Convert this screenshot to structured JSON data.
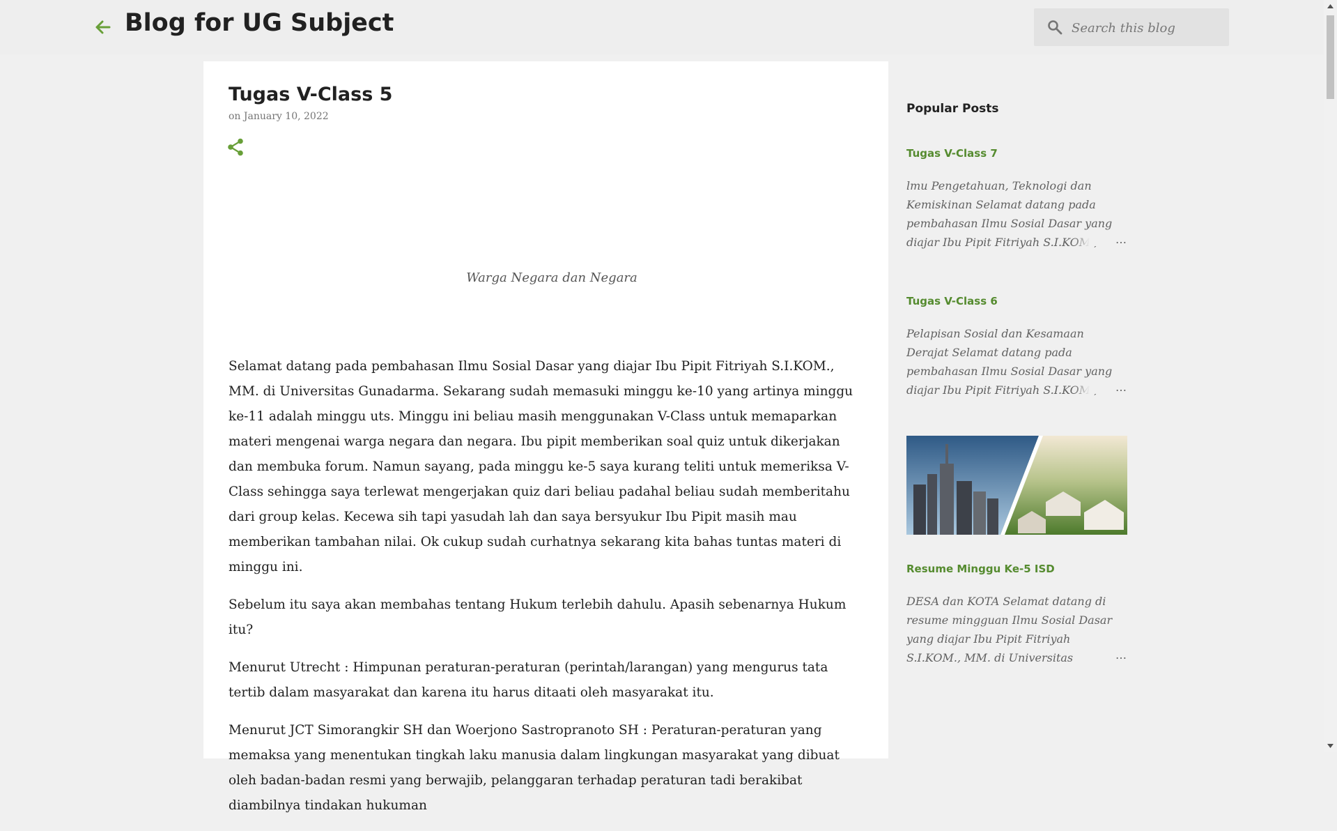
{
  "header": {
    "blog_title": "Blog for UG Subject",
    "search_placeholder": "Search this blog"
  },
  "post": {
    "title": "Tugas V-Class 5",
    "date": "on January 10, 2022",
    "image_caption": "Warga Negara dan Negara",
    "paragraphs": [
      "Selamat datang pada pembahasan Ilmu Sosial Dasar yang diajar Ibu Pipit Fitriyah S.I.KOM., MM. di Universitas Gunadarma. Sekarang sudah memasuki minggu ke-10 yang artinya minggu ke-11 adalah minggu uts. Minggu ini beliau masih  menggunakan V-Class untuk memaparkan materi mengenai warga negara dan negara. Ibu pipit memberikan soal quiz untuk dikerjakan dan membuka forum. Namun sayang, pada minggu ke-5 saya kurang teliti untuk memeriksa V-Class sehingga saya terlewat mengerjakan quiz dari beliau padahal beliau sudah memberitahu dari group kelas. Kecewa sih tapi yasudah lah dan saya bersyukur Ibu Pipit masih mau memberikan tambahan nilai. Ok cukup sudah curhatnya sekarang kita bahas tuntas materi di minggu ini.",
      "Sebelum itu saya akan membahas tentang Hukum terlebih dahulu. Apasih sebenarnya Hukum itu?",
      "Menurut Utrecht : Himpunan peraturan-peraturan (perintah/larangan) yang mengurus tata tertib dalam masyarakat dan karena itu harus ditaati oleh masyarakat itu.",
      "Menurut JCT Simorangkir SH dan Woerjono Sastropranoto SH : Peraturan-peraturan yang memaksa yang menentukan tingkah laku manusia dalam lingkungan masyarakat yang dibuat oleh badan-badan resmi yang berwajib, pelanggaran terhadap peraturan tadi berakibat diambilnya tindakan hukuman"
    ]
  },
  "sidebar": {
    "heading": "Popular Posts",
    "posts": [
      {
        "title": "Tugas V-Class 7",
        "snippet": "lmu Pengetahuan, Teknologi dan Kemiskinan Selamat datang pada pembahasan Ilmu Sosial Dasar yang diajar Ibu Pipit Fitriyah S.I.KOM., MM. di",
        "more": "…"
      },
      {
        "title": "Tugas V-Class 6",
        "snippet": "Pelapisan Sosial dan Kesamaan Derajat Selamat datang pada pembahasan Ilmu Sosial Dasar yang diajar Ibu Pipit Fitriyah S.I.KOM., MM. di Universitas Gunadarma",
        "more": "…"
      },
      {
        "title": "Resume Minggu Ke-5 ISD",
        "snippet": "  DESA dan KOTA Selamat datang di resume mingguan Ilmu Sosial Dasar yang diajar Ibu Pipit Fitriyah S.I.KOM., MM. di Universitas Gunadarma. Pada pertemuan",
        "more": "…"
      }
    ]
  },
  "colors": {
    "accent": "#558b2f",
    "header_bg": "#eeeeee",
    "page_bg": "#f0f0f0"
  }
}
